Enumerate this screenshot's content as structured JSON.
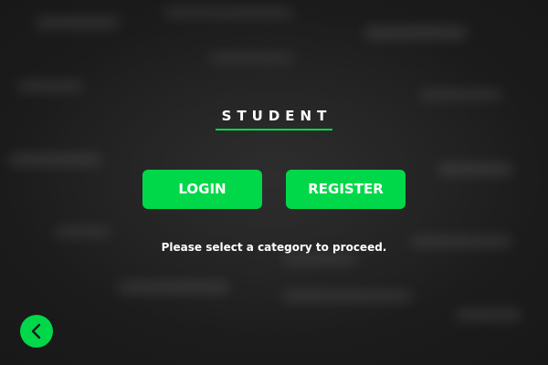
{
  "header": {
    "title": "STUDENT"
  },
  "actions": {
    "login_label": "LOGIN",
    "register_label": "REGISTER"
  },
  "prompt": {
    "text": "Please select a category to proceed."
  },
  "navigation": {
    "back_icon": "chevron-left-icon"
  },
  "colors": {
    "accent": "#00d84a",
    "background": "#1b1b1b",
    "text": "#ffffff"
  }
}
